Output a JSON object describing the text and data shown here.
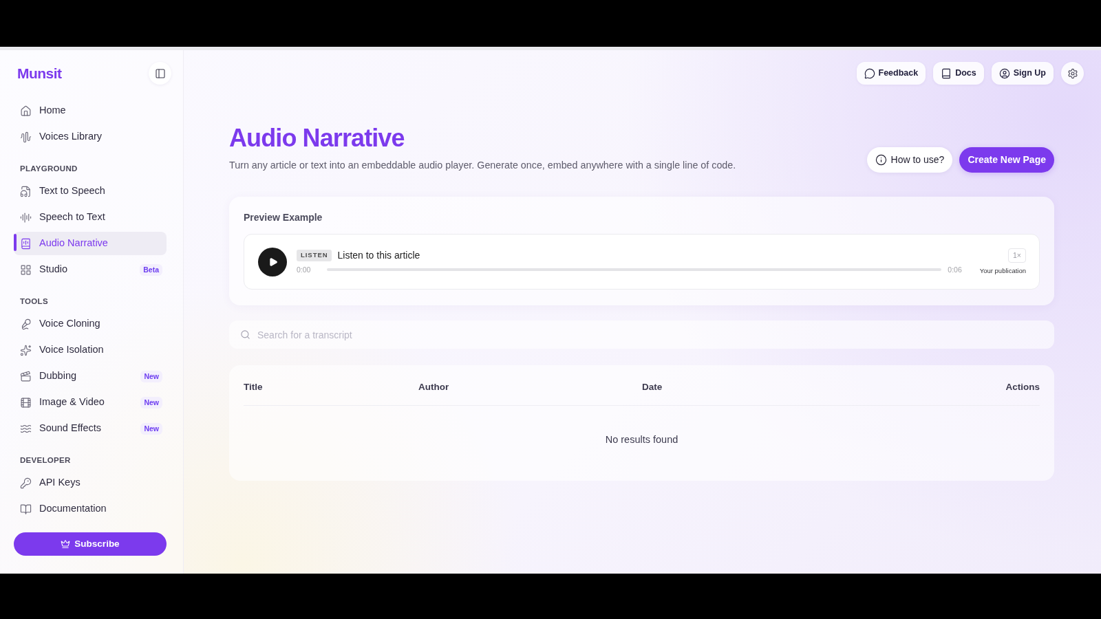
{
  "sidebar": {
    "logo": "Munsit",
    "groups": [
      {
        "items": [
          {
            "label": "Home",
            "selected": false
          },
          {
            "label": "Voices Library",
            "selected": false
          }
        ]
      },
      {
        "heading": "PLAYGROUND",
        "items": [
          {
            "label": "Text to Speech",
            "selected": false
          },
          {
            "label": "Speech to Text",
            "selected": false
          },
          {
            "label": "Audio Narrative",
            "selected": true
          },
          {
            "label": "Studio",
            "selected": false,
            "badge": "Beta"
          }
        ]
      },
      {
        "heading": "TOOLS",
        "items": [
          {
            "label": "Voice Cloning",
            "selected": false
          },
          {
            "label": "Voice Isolation",
            "selected": false
          },
          {
            "label": "Dubbing",
            "selected": false,
            "badge": "New"
          },
          {
            "label": "Image & Video",
            "selected": false,
            "badge": "New"
          },
          {
            "label": "Sound Effects",
            "selected": false,
            "badge": "New"
          }
        ]
      },
      {
        "heading": "DEVELOPER",
        "items": [
          {
            "label": "API Keys",
            "selected": false
          },
          {
            "label": "Documentation",
            "selected": false
          }
        ]
      }
    ],
    "subscribe_button": "Subscribe"
  },
  "header": {
    "actions": [
      "Feedback",
      "Docs",
      "Sign Up"
    ]
  },
  "page": {
    "title": "Audio Narrative",
    "subtitle": "Turn any article or text into an embeddable audio player. Generate once, embed anywhere with a single line of code.",
    "buttons": [
      {
        "label": "How to use?",
        "kind": "secondary"
      },
      {
        "label": "Create New Page",
        "kind": "primary"
      }
    ]
  },
  "preview": {
    "title": "Preview Example",
    "player": {
      "badge": "LISTEN",
      "title": "Listen to this article",
      "current_time": "0:00",
      "duration": "0:06",
      "speed": "1×",
      "publication": "Your publication"
    }
  },
  "search": {
    "placeholder": "Search for a transcript"
  },
  "table": {
    "columns": [
      "Title",
      "Author",
      "Date",
      "Actions"
    ],
    "empty_message": "No results found"
  }
}
